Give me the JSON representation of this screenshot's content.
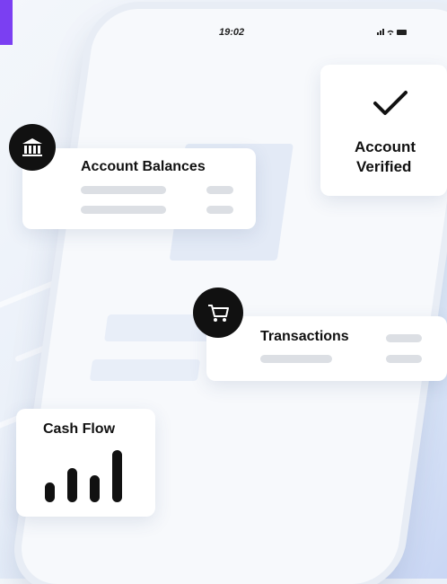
{
  "status_bar": {
    "time": "19:02",
    "icons": "signal wifi battery"
  },
  "account_balances": {
    "title": "Account Balances",
    "icon": "bank-icon"
  },
  "account_verified": {
    "line1": "Account",
    "line2": "Verified",
    "icon": "checkmark-icon"
  },
  "transactions": {
    "title": "Transactions",
    "icon": "shopping-cart-icon"
  },
  "cash_flow": {
    "title": "Cash Flow",
    "icon": "bar-chart-icon"
  },
  "colors": {
    "accent": "#7b3ff2",
    "icon_bg": "#111111",
    "card_bg": "#ffffff",
    "placeholder": "#dcdfe4"
  }
}
